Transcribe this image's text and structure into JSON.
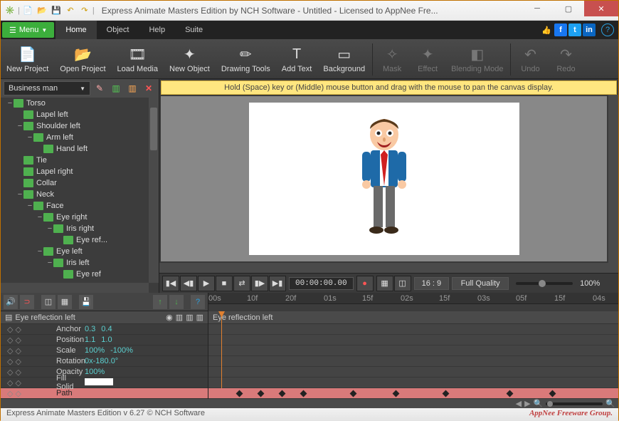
{
  "title": "Express Animate Masters Edition by NCH Software - Untitled - Licensed to AppNee Fre...",
  "menu": {
    "label": "Menu",
    "items": [
      "Home",
      "Object",
      "Help",
      "Suite"
    ],
    "active": 0
  },
  "toolbar": [
    {
      "label": "New Project",
      "icon": "📄",
      "disabled": false
    },
    {
      "label": "Open Project",
      "icon": "📂",
      "disabled": false
    },
    {
      "label": "Load Media",
      "icon": "🎞",
      "disabled": false
    },
    {
      "label": "New Object",
      "icon": "✦",
      "disabled": false
    },
    {
      "label": "Drawing Tools",
      "icon": "✏",
      "disabled": false
    },
    {
      "label": "Add Text",
      "icon": "T",
      "disabled": false
    },
    {
      "label": "Background",
      "icon": "▭",
      "disabled": false
    },
    {
      "label": "Mask",
      "icon": "✧",
      "disabled": true
    },
    {
      "label": "Effect",
      "icon": "✦",
      "disabled": true
    },
    {
      "label": "Blending Mode",
      "icon": "◧",
      "disabled": true
    },
    {
      "label": "Undo",
      "icon": "↶",
      "disabled": true
    },
    {
      "label": "Redo",
      "icon": "↷",
      "disabled": true
    }
  ],
  "combo": "Business man",
  "hint": "Hold (Space) key or (Middle) mouse button and drag with the mouse to pan the canvas display.",
  "tree": [
    {
      "d": 0,
      "exp": "−",
      "t": "Torso"
    },
    {
      "d": 1,
      "exp": "",
      "t": "Lapel left"
    },
    {
      "d": 1,
      "exp": "−",
      "t": "Shoulder left"
    },
    {
      "d": 2,
      "exp": "−",
      "t": "Arm left"
    },
    {
      "d": 3,
      "exp": "",
      "t": "Hand left"
    },
    {
      "d": 1,
      "exp": "",
      "t": "Tie"
    },
    {
      "d": 1,
      "exp": "",
      "t": "Lapel right"
    },
    {
      "d": 1,
      "exp": "",
      "t": "Collar"
    },
    {
      "d": 1,
      "exp": "−",
      "t": "Neck"
    },
    {
      "d": 2,
      "exp": "−",
      "t": "Face"
    },
    {
      "d": 3,
      "exp": "−",
      "t": "Eye right"
    },
    {
      "d": 4,
      "exp": "−",
      "t": "Iris right"
    },
    {
      "d": 5,
      "exp": "",
      "t": "Eye ref..."
    },
    {
      "d": 3,
      "exp": "−",
      "t": "Eye left"
    },
    {
      "d": 4,
      "exp": "−",
      "t": "Iris left"
    },
    {
      "d": 5,
      "exp": "",
      "t": "Eye ref"
    }
  ],
  "timecode": "00:00:00.00",
  "aspect": "16 : 9",
  "quality": "Full Quality",
  "zoom": "100%",
  "ruler": [
    "00s",
    "10f",
    "20f",
    "01s",
    "15f",
    "02s",
    "15f",
    "03s",
    "05f",
    "15f",
    "04s"
  ],
  "track_name": "Eye reflection left",
  "props": [
    {
      "n": "Anchor",
      "v": [
        "0.3",
        "0.4"
      ]
    },
    {
      "n": "Position",
      "v": [
        "1.1",
        "1.0"
      ]
    },
    {
      "n": "Scale",
      "v": [
        "100%",
        "-100%"
      ]
    },
    {
      "n": "Rotation",
      "v": [
        "0x-180.0°"
      ]
    },
    {
      "n": "Opacity",
      "v": [
        "100%"
      ]
    },
    {
      "n": "Fill Solid",
      "v": [
        ""
      ],
      "swatch": true
    },
    {
      "n": "Path",
      "v": [
        ""
      ],
      "hot": true
    }
  ],
  "status": "Express Animate Masters Edition v 6.27 © NCH Software",
  "brand": "AppNee Freeware Group."
}
